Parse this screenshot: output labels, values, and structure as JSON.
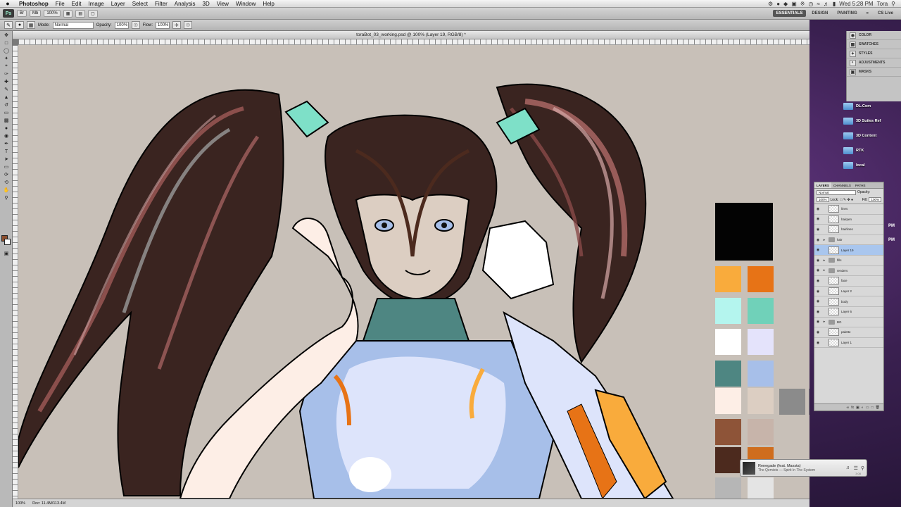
{
  "menubar": {
    "apple": "",
    "app_name": "Photoshop",
    "items": [
      "File",
      "Edit",
      "Image",
      "Layer",
      "Select",
      "Filter",
      "Analysis",
      "3D",
      "View",
      "Window",
      "Help"
    ],
    "clock": "Wed 5:28 PM",
    "user": "Tora"
  },
  "appbar": {
    "logo": "Ps",
    "zoom": "100%",
    "workspaces": [
      "ESSENTIALS",
      "DESIGN",
      "PAINTING"
    ],
    "active_workspace": "ESSENTIALS",
    "more": "»",
    "cslive": "CS Live"
  },
  "options": {
    "mode_label": "Mode:",
    "mode_value": "Normal",
    "opacity_label": "Opacity:",
    "opacity_value": "100%",
    "flow_label": "Flow:",
    "flow_value": "100%"
  },
  "document": {
    "title": "toraBot_03_working.psd @ 100% (Layer 19, RGB/8) *",
    "zoom": "100%",
    "doc_size": "Doc: 11.4M/113.4M"
  },
  "palette": {
    "colors": [
      "#030303",
      "#f9ab3c",
      "#e77316",
      "#b4f5ee",
      "#70d1b9",
      "#ffffff",
      "#e4e3fb",
      "#4e8682",
      "#a7bfe9",
      "#fdeee6",
      "#dccec2",
      "#8b8b8b",
      "#838383",
      "#8e5438",
      "#c7b4aa",
      "#4c2a1e",
      "#cf6d1e",
      "#b6b6b6",
      "#e4e4e4"
    ]
  },
  "right_panels": {
    "items": [
      "COLOR",
      "SWATCHES",
      "STYLES",
      "ADJUSTMENTS",
      "MASKS"
    ]
  },
  "desktop": {
    "folders": [
      "DL.Com",
      "3D Suites Ref",
      "3D Content",
      "RTK",
      "local"
    ],
    "pm1": "PM",
    "pm2": "PM"
  },
  "layers_panel": {
    "tabs": [
      "LAYERS",
      "CHANNELS",
      "PATHS"
    ],
    "blend_mode": "Normal",
    "opacity_label": "Opacity:",
    "opacity_value": "100%",
    "lock_label": "Lock:",
    "fill_label": "Fill:",
    "fill_value": "100%",
    "layers": [
      {
        "name": "lines",
        "type": "layer",
        "selected": false
      },
      {
        "name": "hairpen",
        "type": "layer",
        "selected": false
      },
      {
        "name": "hairlines",
        "type": "layer",
        "selected": false
      },
      {
        "name": "hair",
        "type": "folder",
        "selected": false
      },
      {
        "name": "Layer 19",
        "type": "layer",
        "selected": true
      },
      {
        "name": "fills",
        "type": "folder",
        "selected": false
      },
      {
        "name": "renders",
        "type": "folder",
        "selected": false
      },
      {
        "name": "face",
        "type": "layer",
        "selected": false
      },
      {
        "name": "Layer 2",
        "type": "layer",
        "selected": false
      },
      {
        "name": "body",
        "type": "layer",
        "selected": false
      },
      {
        "name": "Layer 6",
        "type": "layer",
        "selected": false
      },
      {
        "name": "BG",
        "type": "folder",
        "selected": false
      },
      {
        "name": "palette",
        "type": "layer",
        "selected": false
      },
      {
        "name": "Layer 1",
        "type": "layer",
        "selected": false
      }
    ]
  },
  "itunes": {
    "title": "Renegade (feat. Maxsta)",
    "subtitle": "The Qemists — Spirit In The System",
    "time": "3:08"
  }
}
